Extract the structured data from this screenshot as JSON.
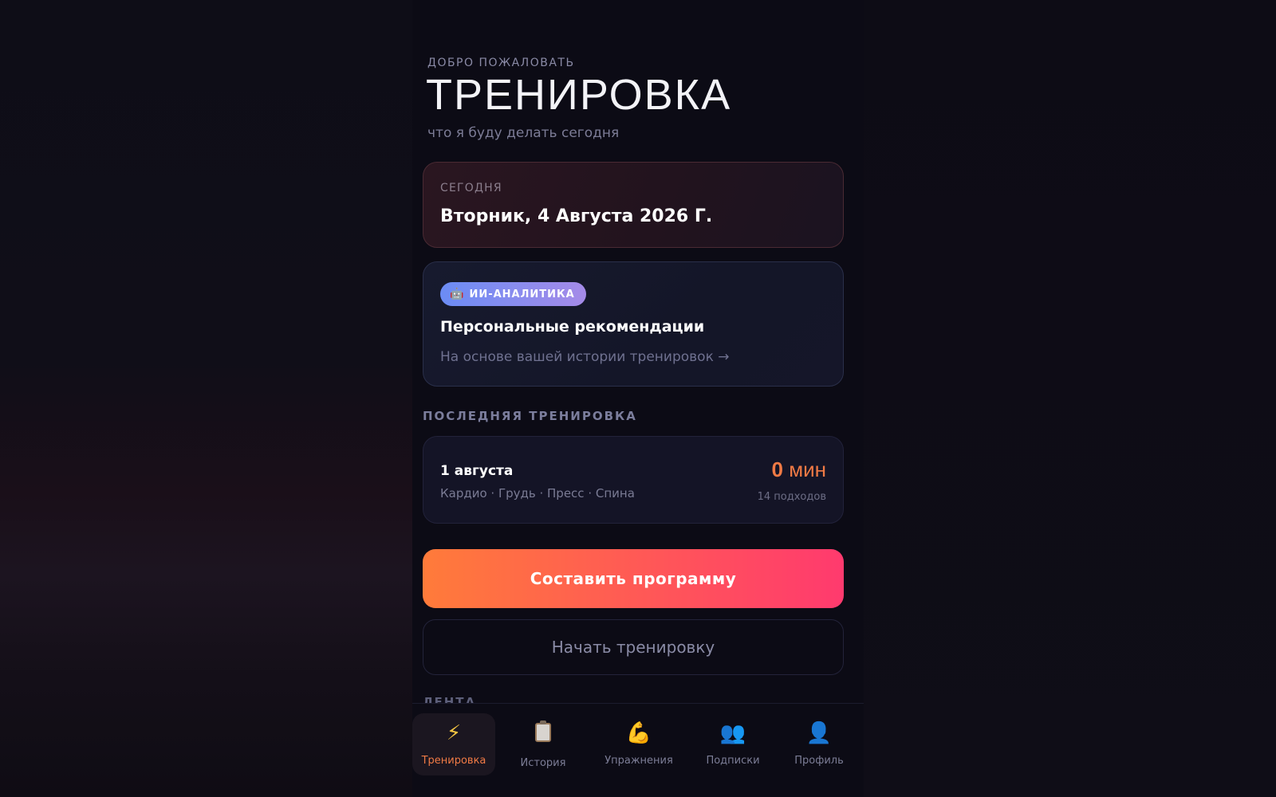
{
  "header": {
    "welcome": "ДОБРО ПОЖАЛОВАТЬ",
    "title": "ТРЕНИРОВКА",
    "subtitle": "что я буду делать сегодня"
  },
  "today": {
    "label": "СЕГОДНЯ",
    "date": "Вторник, 4 Августа 2026 Г."
  },
  "ai": {
    "badge_icon": "robot-icon",
    "badge": "ИИ-АНАЛИТИКА",
    "title": "Персональные рекомендации",
    "subtitle": "На основе вашей истории тренировок →"
  },
  "last_workout": {
    "section_label": "ПОСЛЕДНЯЯ ТРЕНИРОВКА",
    "date": "1 августа",
    "tags": "Кардио · Грудь · Пресс · Спина",
    "duration_value": "0",
    "duration_unit": "мин",
    "sets": "14 подходов"
  },
  "actions": {
    "primary": "Составить программу",
    "secondary": "Начать тренировку"
  },
  "feed": {
    "label": "ЛЕНТА"
  },
  "tabbar": {
    "items": [
      {
        "label": "Тренировка",
        "icon": "lightning-icon",
        "active": true
      },
      {
        "label": "История",
        "icon": "clipboard-icon",
        "active": false
      },
      {
        "label": "Упражнения",
        "icon": "flexed-biceps-icon",
        "active": false
      },
      {
        "label": "Подписки",
        "icon": "people-icon",
        "active": false
      },
      {
        "label": "Профиль",
        "icon": "person-icon",
        "active": false
      }
    ]
  },
  "colors": {
    "accent": "#f07a45",
    "primary_gradient_start": "#ff7b3a",
    "primary_gradient_end": "#ff3a6e",
    "background": "#0c0b15"
  }
}
